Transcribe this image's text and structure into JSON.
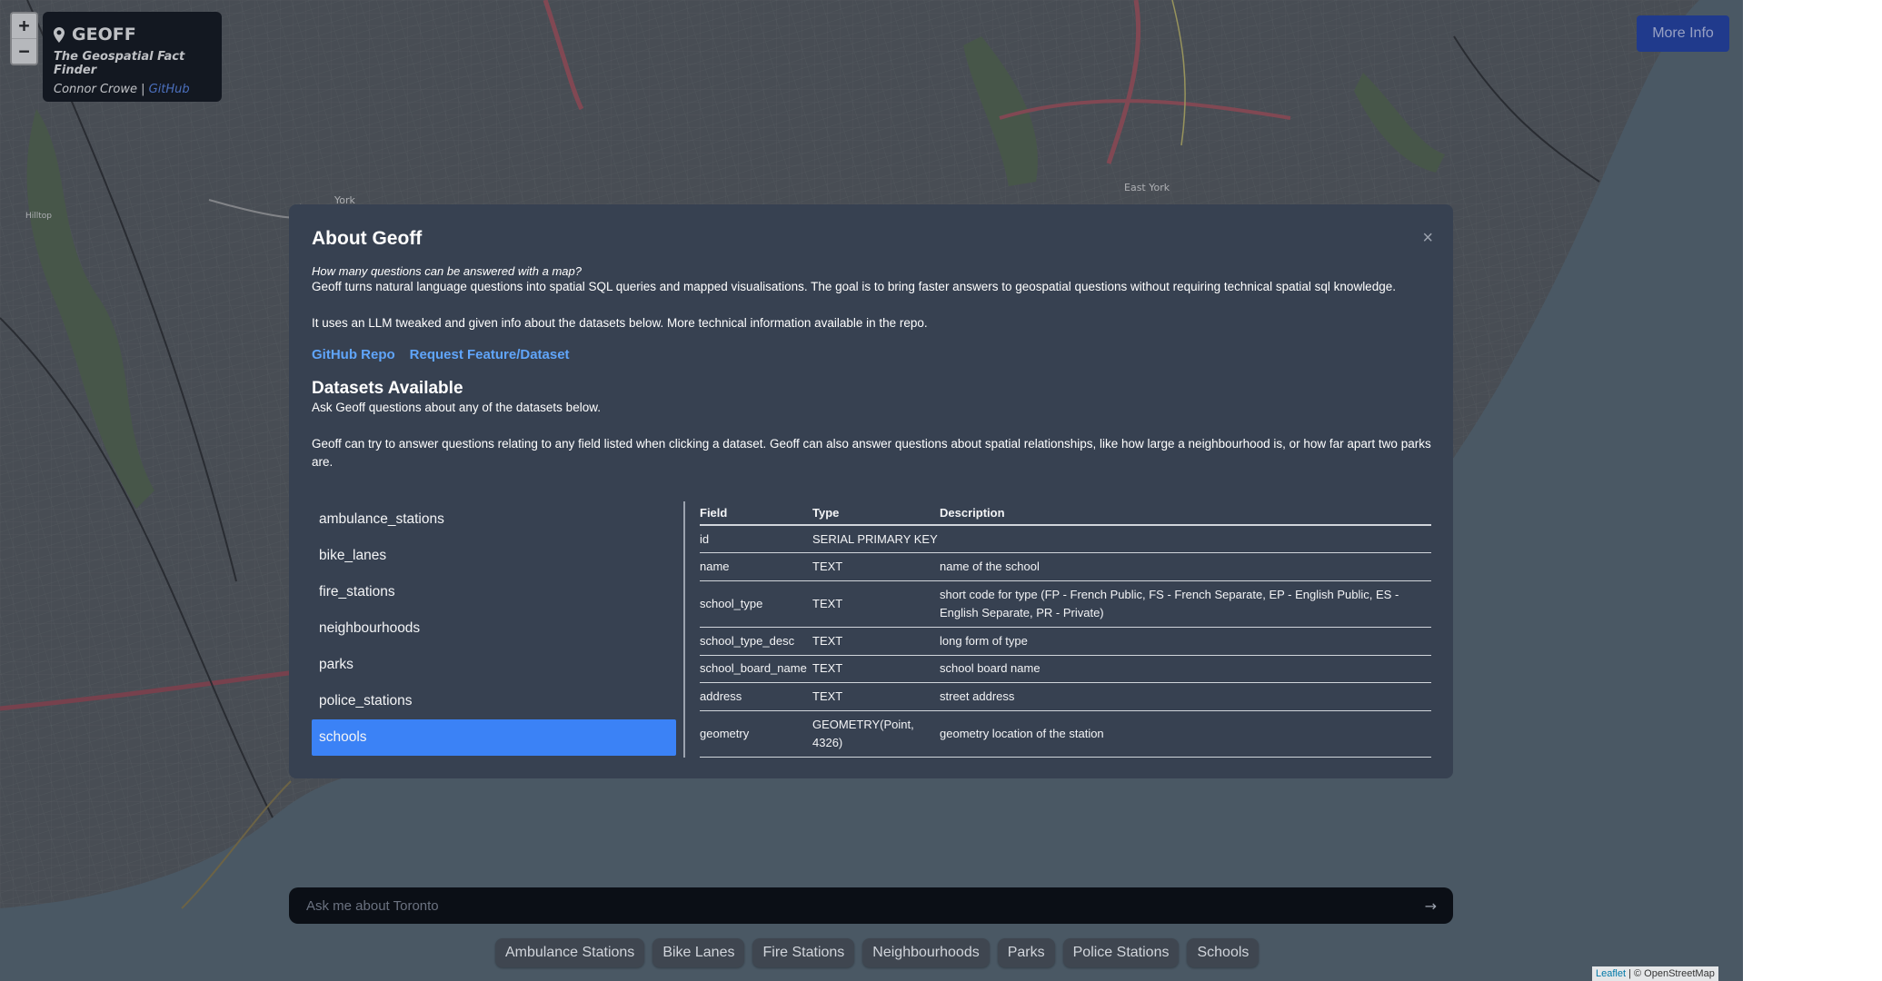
{
  "zoom": {
    "in_label": "+",
    "out_label": "−"
  },
  "brand": {
    "icon": "map-pin-icon",
    "title": "GEOFF",
    "subtitle": "The Geospatial Fact Finder",
    "author": "Connor Crowe",
    "separator": "|",
    "github_link": "GitHub"
  },
  "more_info_label": "More Info",
  "map_labels": {
    "york": "York",
    "east_york": "East York",
    "hilltop": "Hilltop"
  },
  "modal": {
    "title": "About Geoff",
    "close_label": "×",
    "tagline": "How many questions can be answered with a map?",
    "intro": "Geoff turns natural language questions into spatial SQL queries and mapped visualisations. The goal is to bring faster answers to geospatial questions without requiring technical spatial sql knowledge.",
    "llm_note": "It uses an LLM tweaked and given info about the datasets below. More technical information available in the repo.",
    "links": {
      "repo": "GitHub Repo",
      "request": "Request Feature/Dataset"
    },
    "datasets_title": "Datasets Available",
    "datasets_intro": "Ask Geoff questions about any of the datasets below.",
    "datasets_help": "Geoff can try to answer questions relating to any field listed when clicking a dataset. Geoff can also answer questions about spatial relationships, like how large a neighbourhood is, or how far apart two parks are.",
    "datasets": [
      "ambulance_stations",
      "bike_lanes",
      "fire_stations",
      "neighbourhoods",
      "parks",
      "police_stations",
      "schools"
    ],
    "selected_dataset": "schools",
    "table": {
      "headers": {
        "field": "Field",
        "type": "Type",
        "description": "Description"
      },
      "rows": [
        {
          "field": "id",
          "type": "SERIAL PRIMARY KEY",
          "description": ""
        },
        {
          "field": "name",
          "type": "TEXT",
          "description": "name of the school"
        },
        {
          "field": "school_type",
          "type": "TEXT",
          "description": "short code for type (FP - French Public, FS - French Separate, EP - English Public, ES - English Separate, PR - Private)"
        },
        {
          "field": "school_type_desc",
          "type": "TEXT",
          "description": "long form of type"
        },
        {
          "field": "school_board_name",
          "type": "TEXT",
          "description": "school board name"
        },
        {
          "field": "address",
          "type": "TEXT",
          "description": "street address"
        },
        {
          "field": "geometry",
          "type": "GEOMETRY(Point, 4326)",
          "description": "geometry location of the station"
        }
      ]
    }
  },
  "query": {
    "placeholder": "Ask me about Toronto",
    "submit_label": "→"
  },
  "chips": [
    "Ambulance Stations",
    "Bike Lanes",
    "Fire Stations",
    "Neighbourhoods",
    "Parks",
    "Police Stations",
    "Schools"
  ],
  "attribution": {
    "leaflet": "Leaflet",
    "rest": "| © OpenStreetMap"
  },
  "colors": {
    "accent": "#3b82f6",
    "link": "#60a5fa",
    "modal_bg": "#374151",
    "more_info_bg": "#1e40af"
  }
}
